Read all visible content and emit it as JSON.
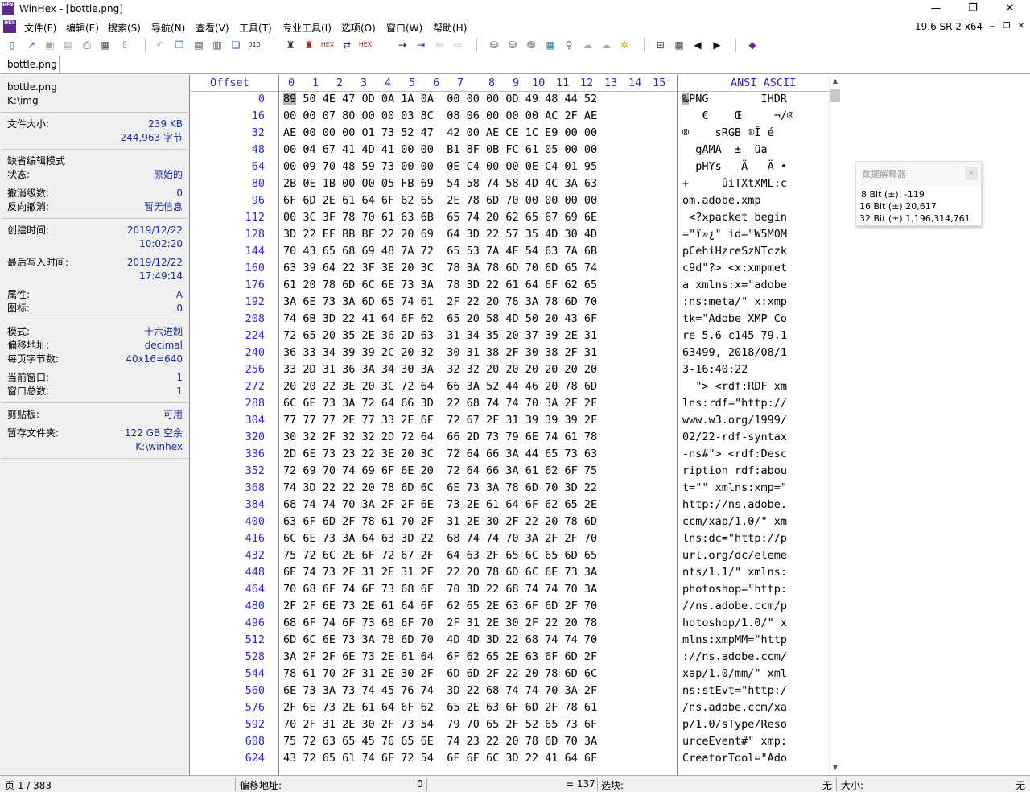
{
  "window": {
    "title": "WinHex - [bottle.png]",
    "app_icon_text": "HEX",
    "minimize": "—",
    "restore": "❐",
    "close": "✕"
  },
  "menu": {
    "items": [
      "文件(F)",
      "编辑(E)",
      "搜索(S)",
      "导航(N)",
      "查看(V)",
      "工具(T)",
      "专业工具(I)",
      "选项(O)",
      "窗口(W)",
      "帮助(H)"
    ],
    "version": "19.6 SR-2 x64",
    "mdi_minimize": "‒",
    "mdi_restore": "❐",
    "mdi_close": "✕"
  },
  "tabs": [
    "bottle.png"
  ],
  "info_panel": {
    "file_name": "bottle.png",
    "file_path": "K:\\img",
    "file_size_label": "文件大小:",
    "file_size_kb": "239 KB",
    "file_size_bytes": "244,963 字节",
    "default_edit_mode_label": "缺省编辑模式",
    "state_label": "状态:",
    "state_value": "原始的",
    "undo_level_label": "撤消级数:",
    "undo_level_value": "0",
    "reverse_undo_label": "反向撤消:",
    "reverse_undo_value": "暂无信息",
    "created_label": "创建时间:",
    "created_date": "2019/12/22",
    "created_time": "10:02:20",
    "modified_label": "最后写入时间:",
    "modified_date": "2019/12/22",
    "modified_time": "17:49:14",
    "attr_label": "属性:",
    "attr_value": "A",
    "icon_label": "图标:",
    "icon_value": "0",
    "mode_label": "模式:",
    "mode_value": "十六进制",
    "offset_label": "偏移地址:",
    "offset_value": "decimal",
    "bytes_per_page_label": "每页字节数:",
    "bytes_per_page_value": "40x16=640",
    "current_window_label": "当前窗口:",
    "current_window_value": "1",
    "total_windows_label": "窗口总数:",
    "total_windows_value": "1",
    "clipboard_label": "剪贴板:",
    "clipboard_value": "可用",
    "temp_folder_label": "暂存文件夹:",
    "temp_folder_free": "122 GB 空余",
    "temp_folder_path": "K:\\winhex"
  },
  "hex_header": {
    "offset": "Offset",
    "columns": [
      "0",
      "1",
      "2",
      "3",
      "4",
      "5",
      "6",
      "7",
      "8",
      "9",
      "10",
      "11",
      "12",
      "13",
      "14",
      "15"
    ],
    "ascii": "ANSI ASCII"
  },
  "hex_rows": [
    {
      "offset": "0",
      "hex": "89 50 4E 47 0D 0A 1A 0A  00 00 00 0D 49 48 44 52",
      "ascii": "‰PNG        IHDR"
    },
    {
      "offset": "16",
      "hex": "00 00 07 80 00 00 03 8C  08 06 00 00 00 AC 2F AE",
      "ascii": "   €    Œ     ¬/®"
    },
    {
      "offset": "32",
      "hex": "AE 00 00 00 01 73 52 47  42 00 AE CE 1C E9 00 00",
      "ascii": "®    sRGB ®Î é  "
    },
    {
      "offset": "48",
      "hex": "00 04 67 41 4D 41 00 00  B1 8F 0B FC 61 05 00 00",
      "ascii": "  gAMA  ±  üa   "
    },
    {
      "offset": "64",
      "hex": "00 09 70 48 59 73 00 00  0E C4 00 00 0E C4 01 95",
      "ascii": "  pHYs   Ä   Ä •"
    },
    {
      "offset": "80",
      "hex": "2B 0E 1B 00 00 05 FB 69  54 58 74 58 4D 4C 3A 63",
      "ascii": "+     ûiTXtXML:c"
    },
    {
      "offset": "96",
      "hex": "6F 6D 2E 61 64 6F 62 65  2E 78 6D 70 00 00 00 00",
      "ascii": "om.adobe.xmp    "
    },
    {
      "offset": "112",
      "hex": "00 3C 3F 78 70 61 63 6B  65 74 20 62 65 67 69 6E",
      "ascii": " <?xpacket begin"
    },
    {
      "offset": "128",
      "hex": "3D 22 EF BB BF 22 20 69  64 3D 22 57 35 4D 30 4D",
      "ascii": "=\"ï»¿\" id=\"W5M0M"
    },
    {
      "offset": "144",
      "hex": "70 43 65 68 69 48 7A 72  65 53 7A 4E 54 63 7A 6B",
      "ascii": "pCehiHzreSzNTczk"
    },
    {
      "offset": "160",
      "hex": "63 39 64 22 3F 3E 20 3C  78 3A 78 6D 70 6D 65 74",
      "ascii": "c9d\"?> <x:xmpmet"
    },
    {
      "offset": "176",
      "hex": "61 20 78 6D 6C 6E 73 3A  78 3D 22 61 64 6F 62 65",
      "ascii": "a xmlns:x=\"adobe"
    },
    {
      "offset": "192",
      "hex": "3A 6E 73 3A 6D 65 74 61  2F 22 20 78 3A 78 6D 70",
      "ascii": ":ns:meta/\" x:xmp"
    },
    {
      "offset": "208",
      "hex": "74 6B 3D 22 41 64 6F 62  65 20 58 4D 50 20 43 6F",
      "ascii": "tk=\"Adobe XMP Co"
    },
    {
      "offset": "224",
      "hex": "72 65 20 35 2E 36 2D 63  31 34 35 20 37 39 2E 31",
      "ascii": "re 5.6-c145 79.1"
    },
    {
      "offset": "240",
      "hex": "36 33 34 39 39 2C 20 32  30 31 38 2F 30 38 2F 31",
      "ascii": "63499, 2018/08/1"
    },
    {
      "offset": "256",
      "hex": "33 2D 31 36 3A 34 30 3A  32 32 20 20 20 20 20 20",
      "ascii": "3-16:40:22      "
    },
    {
      "offset": "272",
      "hex": "20 20 22 3E 20 3C 72 64  66 3A 52 44 46 20 78 6D",
      "ascii": "  \"> <rdf:RDF xm"
    },
    {
      "offset": "288",
      "hex": "6C 6E 73 3A 72 64 66 3D  22 68 74 74 70 3A 2F 2F",
      "ascii": "lns:rdf=\"http://"
    },
    {
      "offset": "304",
      "hex": "77 77 77 2E 77 33 2E 6F  72 67 2F 31 39 39 39 2F",
      "ascii": "www.w3.org/1999/"
    },
    {
      "offset": "320",
      "hex": "30 32 2F 32 32 2D 72 64  66 2D 73 79 6E 74 61 78",
      "ascii": "02/22-rdf-syntax"
    },
    {
      "offset": "336",
      "hex": "2D 6E 73 23 22 3E 20 3C  72 64 66 3A 44 65 73 63",
      "ascii": "-ns#\"> <rdf:Desc"
    },
    {
      "offset": "352",
      "hex": "72 69 70 74 69 6F 6E 20  72 64 66 3A 61 62 6F 75",
      "ascii": "ription rdf:abou"
    },
    {
      "offset": "368",
      "hex": "74 3D 22 22 20 78 6D 6C  6E 73 3A 78 6D 70 3D 22",
      "ascii": "t=\"\" xmlns:xmp=\""
    },
    {
      "offset": "384",
      "hex": "68 74 74 70 3A 2F 2F 6E  73 2E 61 64 6F 62 65 2E",
      "ascii": "http://ns.adobe."
    },
    {
      "offset": "400",
      "hex": "63 6F 6D 2F 78 61 70 2F  31 2E 30 2F 22 20 78 6D",
      "ascii": "ccm/xap/1.0/\" xm"
    },
    {
      "offset": "416",
      "hex": "6C 6E 73 3A 64 63 3D 22  68 74 74 70 3A 2F 2F 70",
      "ascii": "lns:dc=\"http://p"
    },
    {
      "offset": "432",
      "hex": "75 72 6C 2E 6F 72 67 2F  64 63 2F 65 6C 65 6D 65",
      "ascii": "url.org/dc/eleme"
    },
    {
      "offset": "448",
      "hex": "6E 74 73 2F 31 2E 31 2F  22 20 78 6D 6C 6E 73 3A",
      "ascii": "nts/1.1/\" xmlns:"
    },
    {
      "offset": "464",
      "hex": "70 68 6F 74 6F 73 68 6F  70 3D 22 68 74 74 70 3A",
      "ascii": "photoshop=\"http:"
    },
    {
      "offset": "480",
      "hex": "2F 2F 6E 73 2E 61 64 6F  62 65 2E 63 6F 6D 2F 70",
      "ascii": "//ns.adobe.ccm/p"
    },
    {
      "offset": "496",
      "hex": "68 6F 74 6F 73 68 6F 70  2F 31 2E 30 2F 22 20 78",
      "ascii": "hotoshop/1.0/\" x"
    },
    {
      "offset": "512",
      "hex": "6D 6C 6E 73 3A 78 6D 70  4D 4D 3D 22 68 74 74 70",
      "ascii": "mlns:xmpMM=\"http"
    },
    {
      "offset": "528",
      "hex": "3A 2F 2F 6E 73 2E 61 64  6F 62 65 2E 63 6F 6D 2F",
      "ascii": "://ns.adobe.ccm/"
    },
    {
      "offset": "544",
      "hex": "78 61 70 2F 31 2E 30 2F  6D 6D 2F 22 20 78 6D 6C",
      "ascii": "xap/1.0/mm/\" xml"
    },
    {
      "offset": "560",
      "hex": "6E 73 3A 73 74 45 76 74  3D 22 68 74 74 70 3A 2F",
      "ascii": "ns:stEvt=\"http:/"
    },
    {
      "offset": "576",
      "hex": "2F 6E 73 2E 61 64 6F 62  65 2E 63 6F 6D 2F 78 61",
      "ascii": "/ns.adobe.ccm/xa"
    },
    {
      "offset": "592",
      "hex": "70 2F 31 2E 30 2F 73 54  79 70 65 2F 52 65 73 6F",
      "ascii": "p/1.0/sType/Reso"
    },
    {
      "offset": "608",
      "hex": "75 72 63 65 45 76 65 6E  74 23 22 20 78 6D 70 3A",
      "ascii": "urceEvent#\" xmp:"
    },
    {
      "offset": "624",
      "hex": "43 72 65 61 74 6F 72 54  6F 6F 6C 3D 22 41 64 6F",
      "ascii": "CreatorTool=\"Ado"
    }
  ],
  "data_interpreter": {
    "title": "数据解释器",
    "close": "✕",
    "rows": [
      "8 Bit (±): -119",
      "16 Bit (±) 20,617",
      "32 Bit (±) 1,196,314,761"
    ]
  },
  "status_bar": {
    "page": "页 1 / 383",
    "offset_label": "偏移地址:",
    "offset_value": "0",
    "decimal_value": "= 137",
    "selection_label": "选块:",
    "selection_value": "无",
    "size_label": "大小:",
    "size_value": "无"
  }
}
